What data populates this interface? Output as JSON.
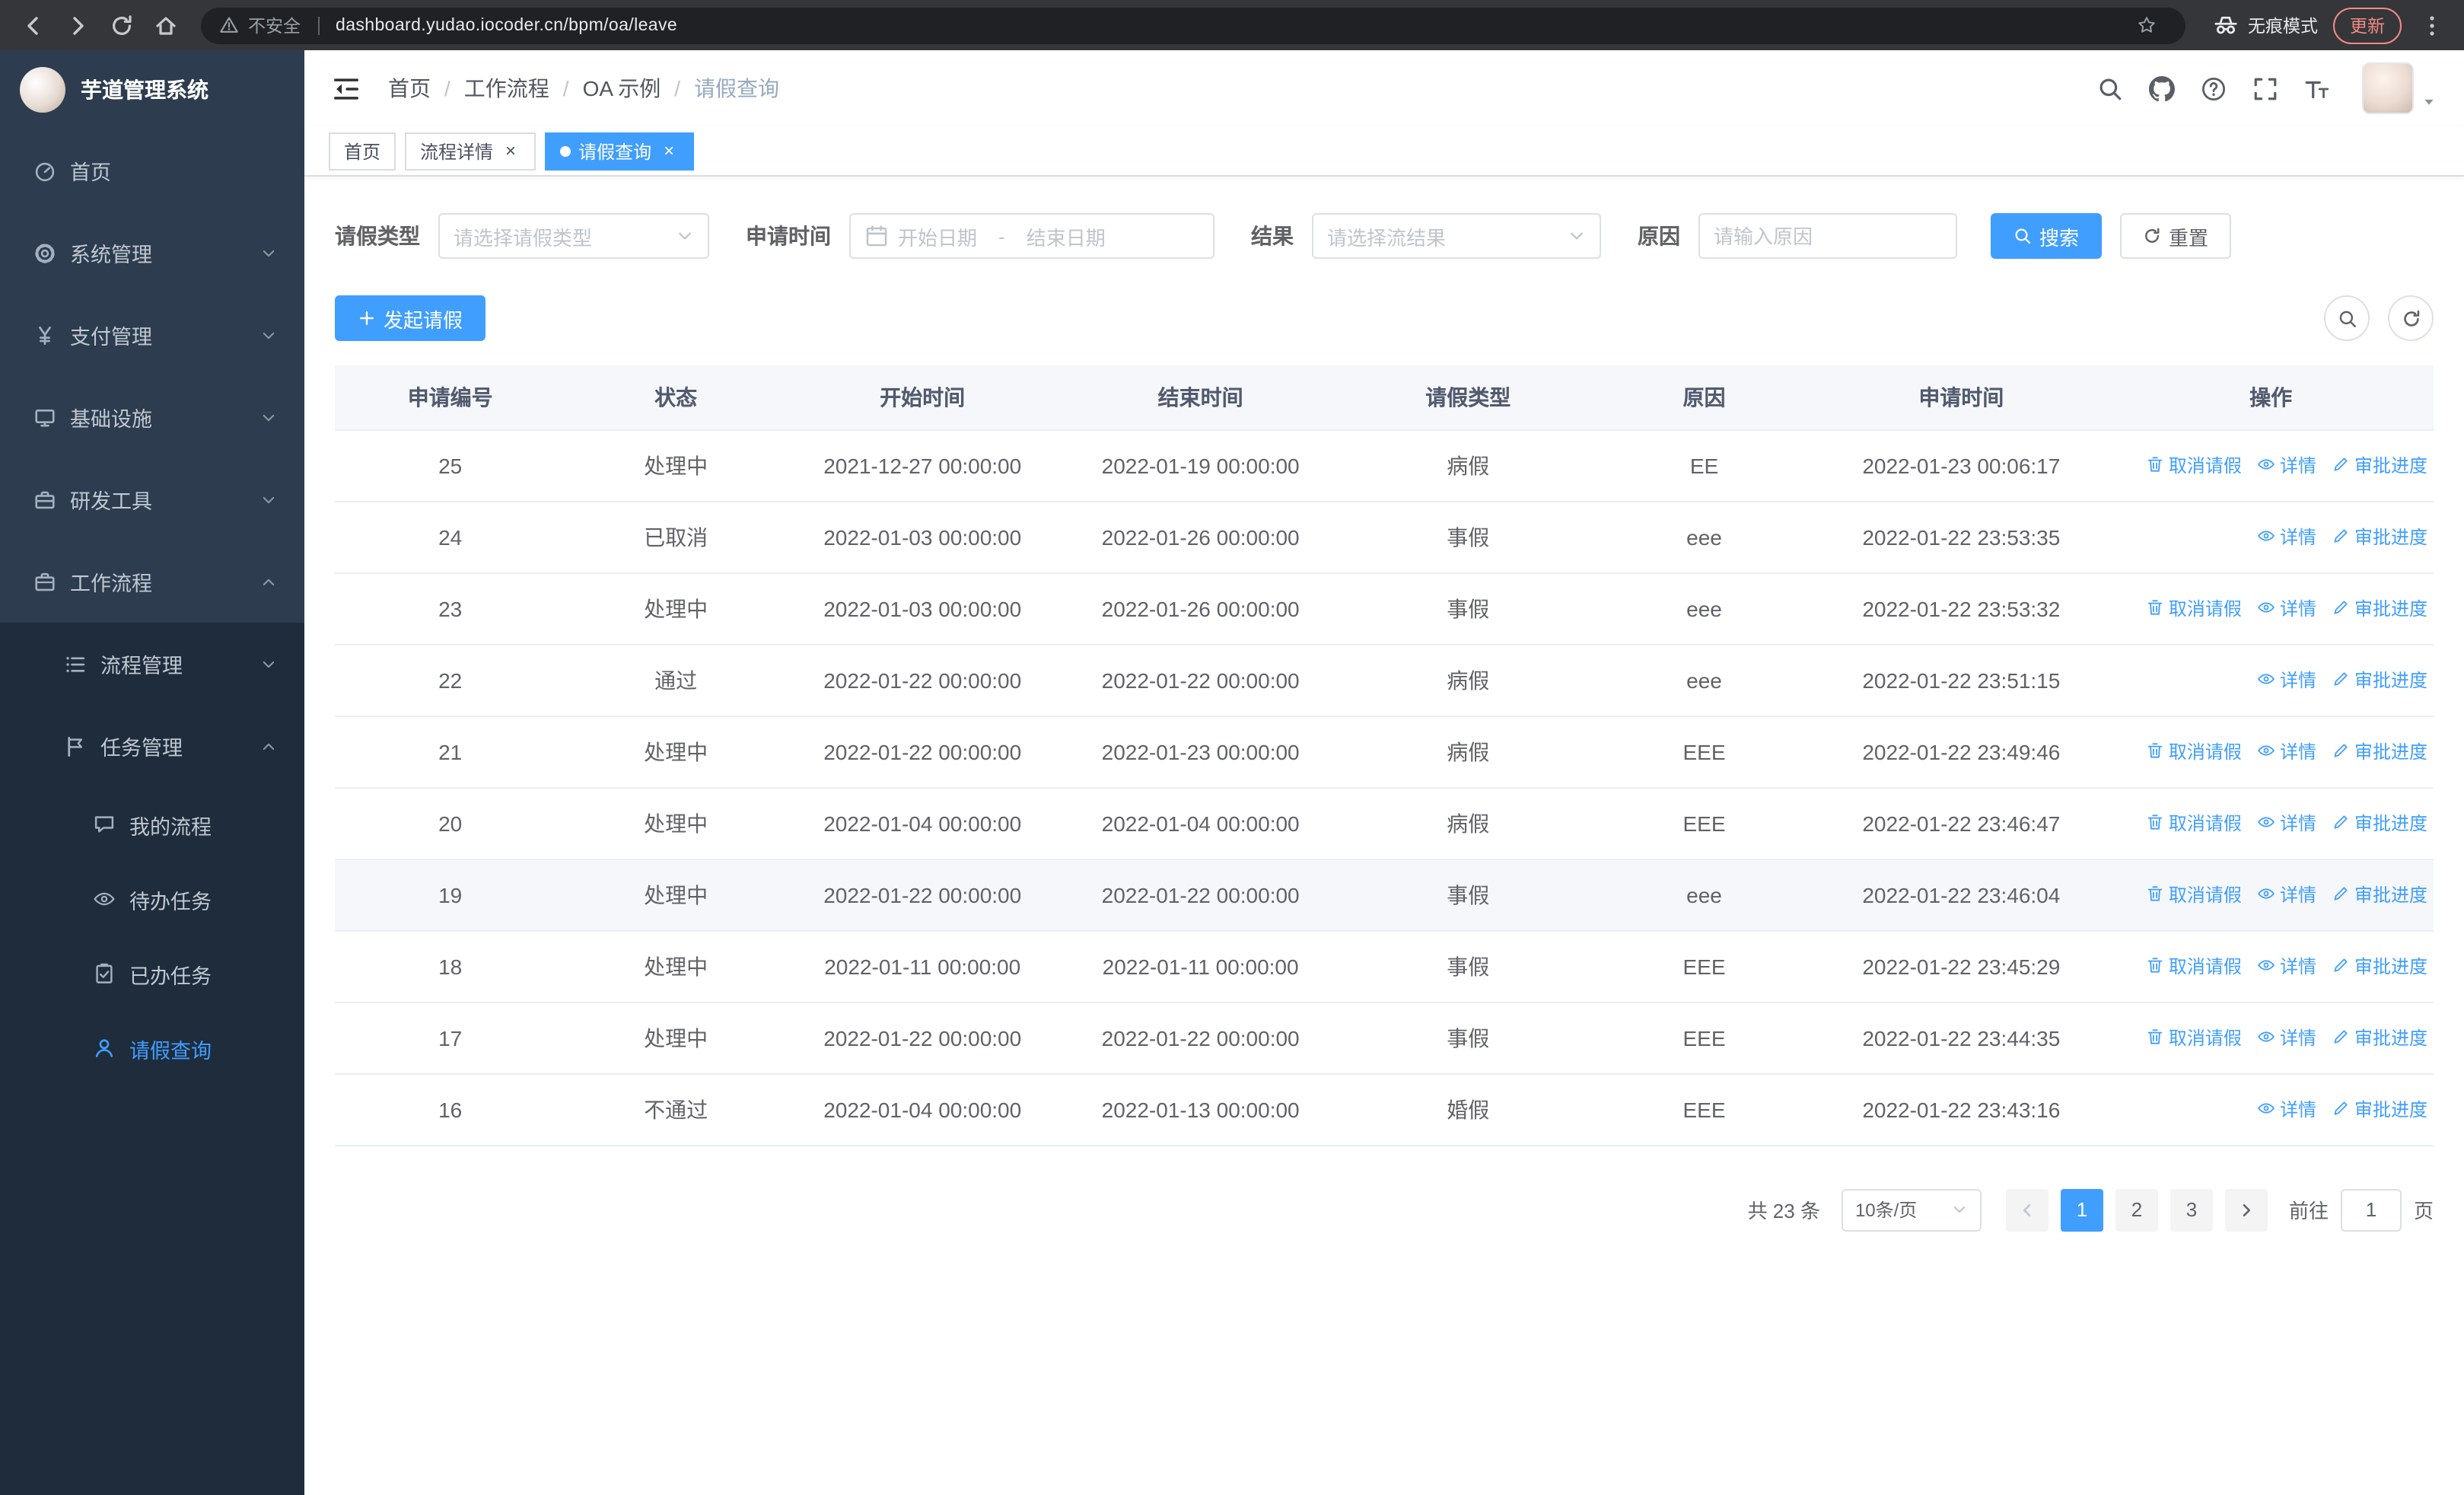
{
  "browser": {
    "security_label": "不安全",
    "url": "dashboard.yudao.iocoder.cn/bpm/oa/leave",
    "incognito_label": "无痕模式",
    "update_label": "更新"
  },
  "sidebar": {
    "title": "芋道管理系统",
    "menu": [
      {
        "label": "首页",
        "icon": "dashboard-icon",
        "level": 1
      },
      {
        "label": "系统管理",
        "icon": "gear-icon",
        "level": 1,
        "chevron": "down"
      },
      {
        "label": "支付管理",
        "icon": "yen-icon",
        "level": 1,
        "chevron": "down"
      },
      {
        "label": "基础设施",
        "icon": "monitor-icon",
        "level": 1,
        "chevron": "down"
      },
      {
        "label": "研发工具",
        "icon": "toolbox-icon",
        "level": 1,
        "chevron": "down"
      },
      {
        "label": "工作流程",
        "icon": "briefcase-icon",
        "level": 1,
        "chevron": "up"
      },
      {
        "label": "流程管理",
        "icon": "list-icon",
        "level": 2,
        "chevron": "down"
      },
      {
        "label": "任务管理",
        "icon": "flag-icon",
        "level": 2,
        "chevron": "up"
      },
      {
        "label": "我的流程",
        "icon": "chat-icon",
        "level": 3
      },
      {
        "label": "待办任务",
        "icon": "eye-icon",
        "level": 3
      },
      {
        "label": "已办任务",
        "icon": "clipboard-check-icon",
        "level": 3
      },
      {
        "label": "请假查询",
        "icon": "user-icon",
        "level": 3,
        "active": true
      }
    ]
  },
  "header": {
    "breadcrumb": [
      "首页",
      "工作流程",
      "OA 示例",
      "请假查询"
    ]
  },
  "tabs": [
    {
      "label": "首页",
      "closable": false,
      "active": false
    },
    {
      "label": "流程详情",
      "closable": true,
      "active": false
    },
    {
      "label": "请假查询",
      "closable": true,
      "active": true
    }
  ],
  "filters": {
    "leave_type_label": "请假类型",
    "leave_type_placeholder": "请选择请假类型",
    "apply_time_label": "申请时间",
    "start_date_placeholder": "开始日期",
    "range_separator": "-",
    "end_date_placeholder": "结束日期",
    "result_label": "结果",
    "result_placeholder": "请选择流结果",
    "reason_label": "原因",
    "reason_placeholder": "请输入原因",
    "search_button": "搜索",
    "reset_button": "重置"
  },
  "toolbar": {
    "create_button": "发起请假"
  },
  "table": {
    "columns": [
      "申请编号",
      "状态",
      "开始时间",
      "结束时间",
      "请假类型",
      "原因",
      "申请时间",
      "操作"
    ],
    "action_labels": {
      "cancel": "取消请假",
      "detail": "详情",
      "progress": "审批进度"
    },
    "rows": [
      {
        "id": "25",
        "status": "处理中",
        "start": "2021-12-27 00:00:00",
        "end": "2022-01-19 00:00:00",
        "type": "病假",
        "reason": "EE",
        "apply_time": "2022-01-23 00:06:17",
        "actions": [
          "cancel",
          "detail",
          "progress"
        ]
      },
      {
        "id": "24",
        "status": "已取消",
        "start": "2022-01-03 00:00:00",
        "end": "2022-01-26 00:00:00",
        "type": "事假",
        "reason": "eee",
        "apply_time": "2022-01-22 23:53:35",
        "actions": [
          "detail",
          "progress"
        ]
      },
      {
        "id": "23",
        "status": "处理中",
        "start": "2022-01-03 00:00:00",
        "end": "2022-01-26 00:00:00",
        "type": "事假",
        "reason": "eee",
        "apply_time": "2022-01-22 23:53:32",
        "actions": [
          "cancel",
          "detail",
          "progress"
        ]
      },
      {
        "id": "22",
        "status": "通过",
        "start": "2022-01-22 00:00:00",
        "end": "2022-01-22 00:00:00",
        "type": "病假",
        "reason": "eee",
        "apply_time": "2022-01-22 23:51:15",
        "actions": [
          "detail",
          "progress"
        ]
      },
      {
        "id": "21",
        "status": "处理中",
        "start": "2022-01-22 00:00:00",
        "end": "2022-01-23 00:00:00",
        "type": "病假",
        "reason": "EEE",
        "apply_time": "2022-01-22 23:49:46",
        "actions": [
          "cancel",
          "detail",
          "progress"
        ]
      },
      {
        "id": "20",
        "status": "处理中",
        "start": "2022-01-04 00:00:00",
        "end": "2022-01-04 00:00:00",
        "type": "病假",
        "reason": "EEE",
        "apply_time": "2022-01-22 23:46:47",
        "actions": [
          "cancel",
          "detail",
          "progress"
        ]
      },
      {
        "id": "19",
        "status": "处理中",
        "start": "2022-01-22 00:00:00",
        "end": "2022-01-22 00:00:00",
        "type": "事假",
        "reason": "eee",
        "apply_time": "2022-01-22 23:46:04",
        "actions": [
          "cancel",
          "detail",
          "progress"
        ],
        "highlighted": true
      },
      {
        "id": "18",
        "status": "处理中",
        "start": "2022-01-11 00:00:00",
        "end": "2022-01-11 00:00:00",
        "type": "事假",
        "reason": "EEE",
        "apply_time": "2022-01-22 23:45:29",
        "actions": [
          "cancel",
          "detail",
          "progress"
        ]
      },
      {
        "id": "17",
        "status": "处理中",
        "start": "2022-01-22 00:00:00",
        "end": "2022-01-22 00:00:00",
        "type": "事假",
        "reason": "EEE",
        "apply_time": "2022-01-22 23:44:35",
        "actions": [
          "cancel",
          "detail",
          "progress"
        ]
      },
      {
        "id": "16",
        "status": "不通过",
        "start": "2022-01-04 00:00:00",
        "end": "2022-01-13 00:00:00",
        "type": "婚假",
        "reason": "EEE",
        "apply_time": "2022-01-22 23:43:16",
        "actions": [
          "detail",
          "progress"
        ]
      }
    ]
  },
  "pagination": {
    "total_text": "共 23 条",
    "page_size": "10条/页",
    "pages": [
      "1",
      "2",
      "3"
    ],
    "active_page": "1",
    "goto_label": "前往",
    "goto_value": "1",
    "page_label": "页"
  }
}
